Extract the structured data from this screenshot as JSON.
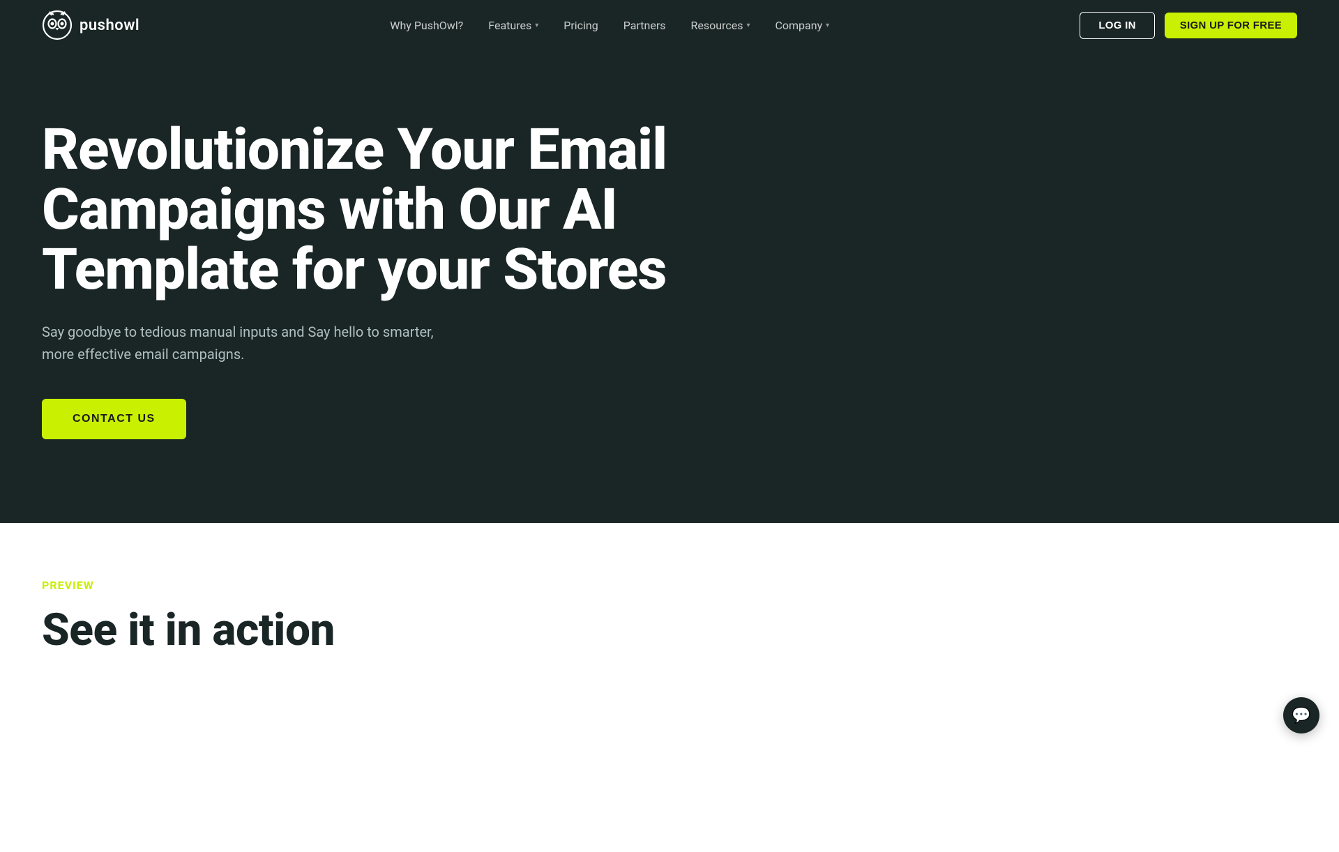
{
  "navbar": {
    "logo_text": "pushowl",
    "nav_items": [
      {
        "label": "Why PushOwl?",
        "has_dropdown": false
      },
      {
        "label": "Features",
        "has_dropdown": true
      },
      {
        "label": "Pricing",
        "has_dropdown": false
      },
      {
        "label": "Partners",
        "has_dropdown": false
      },
      {
        "label": "Resources",
        "has_dropdown": true
      },
      {
        "label": "Company",
        "has_dropdown": true
      }
    ],
    "login_label": "LOG IN",
    "signup_label": "SIGN UP FOR FREE"
  },
  "hero": {
    "title": "Revolutionize Your Email Campaigns with Our AI Template for your Stores",
    "subtitle": "Say goodbye to tedious manual inputs and Say hello to smarter, more effective email campaigns.",
    "cta_label": "CONTACT US"
  },
  "preview_section": {
    "label": "PREVIEW",
    "title": "See it in action"
  },
  "colors": {
    "accent": "#c8f000",
    "dark_bg": "#1a2626",
    "white": "#ffffff"
  }
}
